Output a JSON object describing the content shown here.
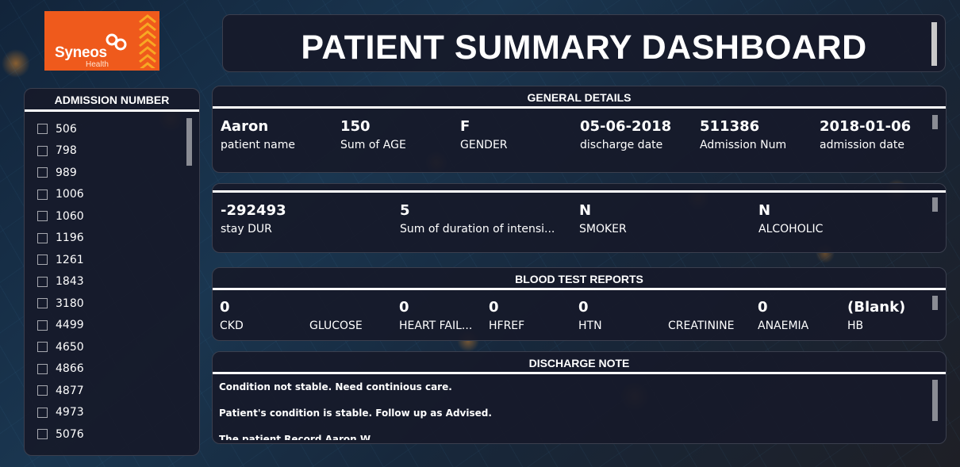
{
  "logo": {
    "brand": "Syneos",
    "sub": "Health"
  },
  "title": "PATIENT SUMMARY DASHBOARD",
  "slicer": {
    "title": "ADMISSION NUMBER",
    "items": [
      "506",
      "798",
      "989",
      "1006",
      "1060",
      "1196",
      "1261",
      "1843",
      "3180",
      "4499",
      "4650",
      "4866",
      "4877",
      "4973",
      "5076"
    ]
  },
  "general": {
    "title": "GENERAL DETAILS",
    "cards": [
      {
        "value": "Aaron",
        "label": "patient name"
      },
      {
        "value": "150",
        "label": "Sum of AGE"
      },
      {
        "value": "F",
        "label": "GENDER"
      },
      {
        "value": "05-06-2018",
        "label": "discharge date"
      },
      {
        "value": "511386",
        "label": "Admission Num"
      },
      {
        "value": "2018-01-06",
        "label": "admission date"
      }
    ]
  },
  "stay": {
    "cards": [
      {
        "value": "-292493",
        "label": "stay DUR"
      },
      {
        "value": "5",
        "label": "Sum of duration of intensi..."
      },
      {
        "value": "N",
        "label": "SMOKER"
      },
      {
        "value": "N",
        "label": "ALCOHOLIC"
      }
    ]
  },
  "blood": {
    "title": "BLOOD TEST REPORTS",
    "cards": [
      {
        "value": "0",
        "label": "CKD"
      },
      {
        "value": "",
        "label": "GLUCOSE"
      },
      {
        "value": "0",
        "label": "HEART FAIL..."
      },
      {
        "value": "0",
        "label": "HFREF"
      },
      {
        "value": "0",
        "label": "HTN"
      },
      {
        "value": "",
        "label": "CREATININE"
      },
      {
        "value": "0",
        "label": "ANAEMIA"
      },
      {
        "value": "(Blank)",
        "label": "HB"
      }
    ]
  },
  "discharge": {
    "title": "DISCHARGE NOTE",
    "notes": [
      "Condition not stable. Need continious care.",
      "Patient's condition is stable. Follow up as Advised.",
      "The patient Record Aaron W..."
    ]
  },
  "colors": {
    "brand_orange": "#ef5a1c",
    "panel": "#171a2a",
    "text": "#ffffff"
  }
}
